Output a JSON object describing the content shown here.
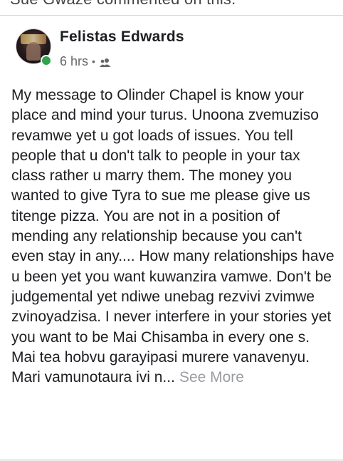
{
  "previous_activity": {
    "text": "Sue Gwaze commented on this."
  },
  "post": {
    "author": "Felistas Edwards",
    "time": "6 hrs",
    "separator": "•",
    "privacy_icon": "friends-icon",
    "body": "My message to Olinder Chapel is know your place and mind your turus. Unoona zvemuziso revamwe yet u got loads of issues. You tell people that u don't talk to people in your tax class rather u marry them. The money you wanted to give Tyra to sue me please give us titenge pizza. You are not in a position of mending any relationship because you can't even stay in any.... How many relationships have u been yet you want kuwanzira vamwe. Don't be judgemental yet ndiwe unebag rezvivi zvimwe zvinoyadzisa. I never interfere in your stories yet you want to be Mai Chisamba in every one s. Mai tea hobvu garayipasi murere vanavenyu. Mari vamunotaura ivi n...",
    "see_more_label": "See More"
  },
  "colors": {
    "online_status": "#31a24c",
    "meta_text": "#65676b",
    "see_more": "#9a9da2"
  }
}
